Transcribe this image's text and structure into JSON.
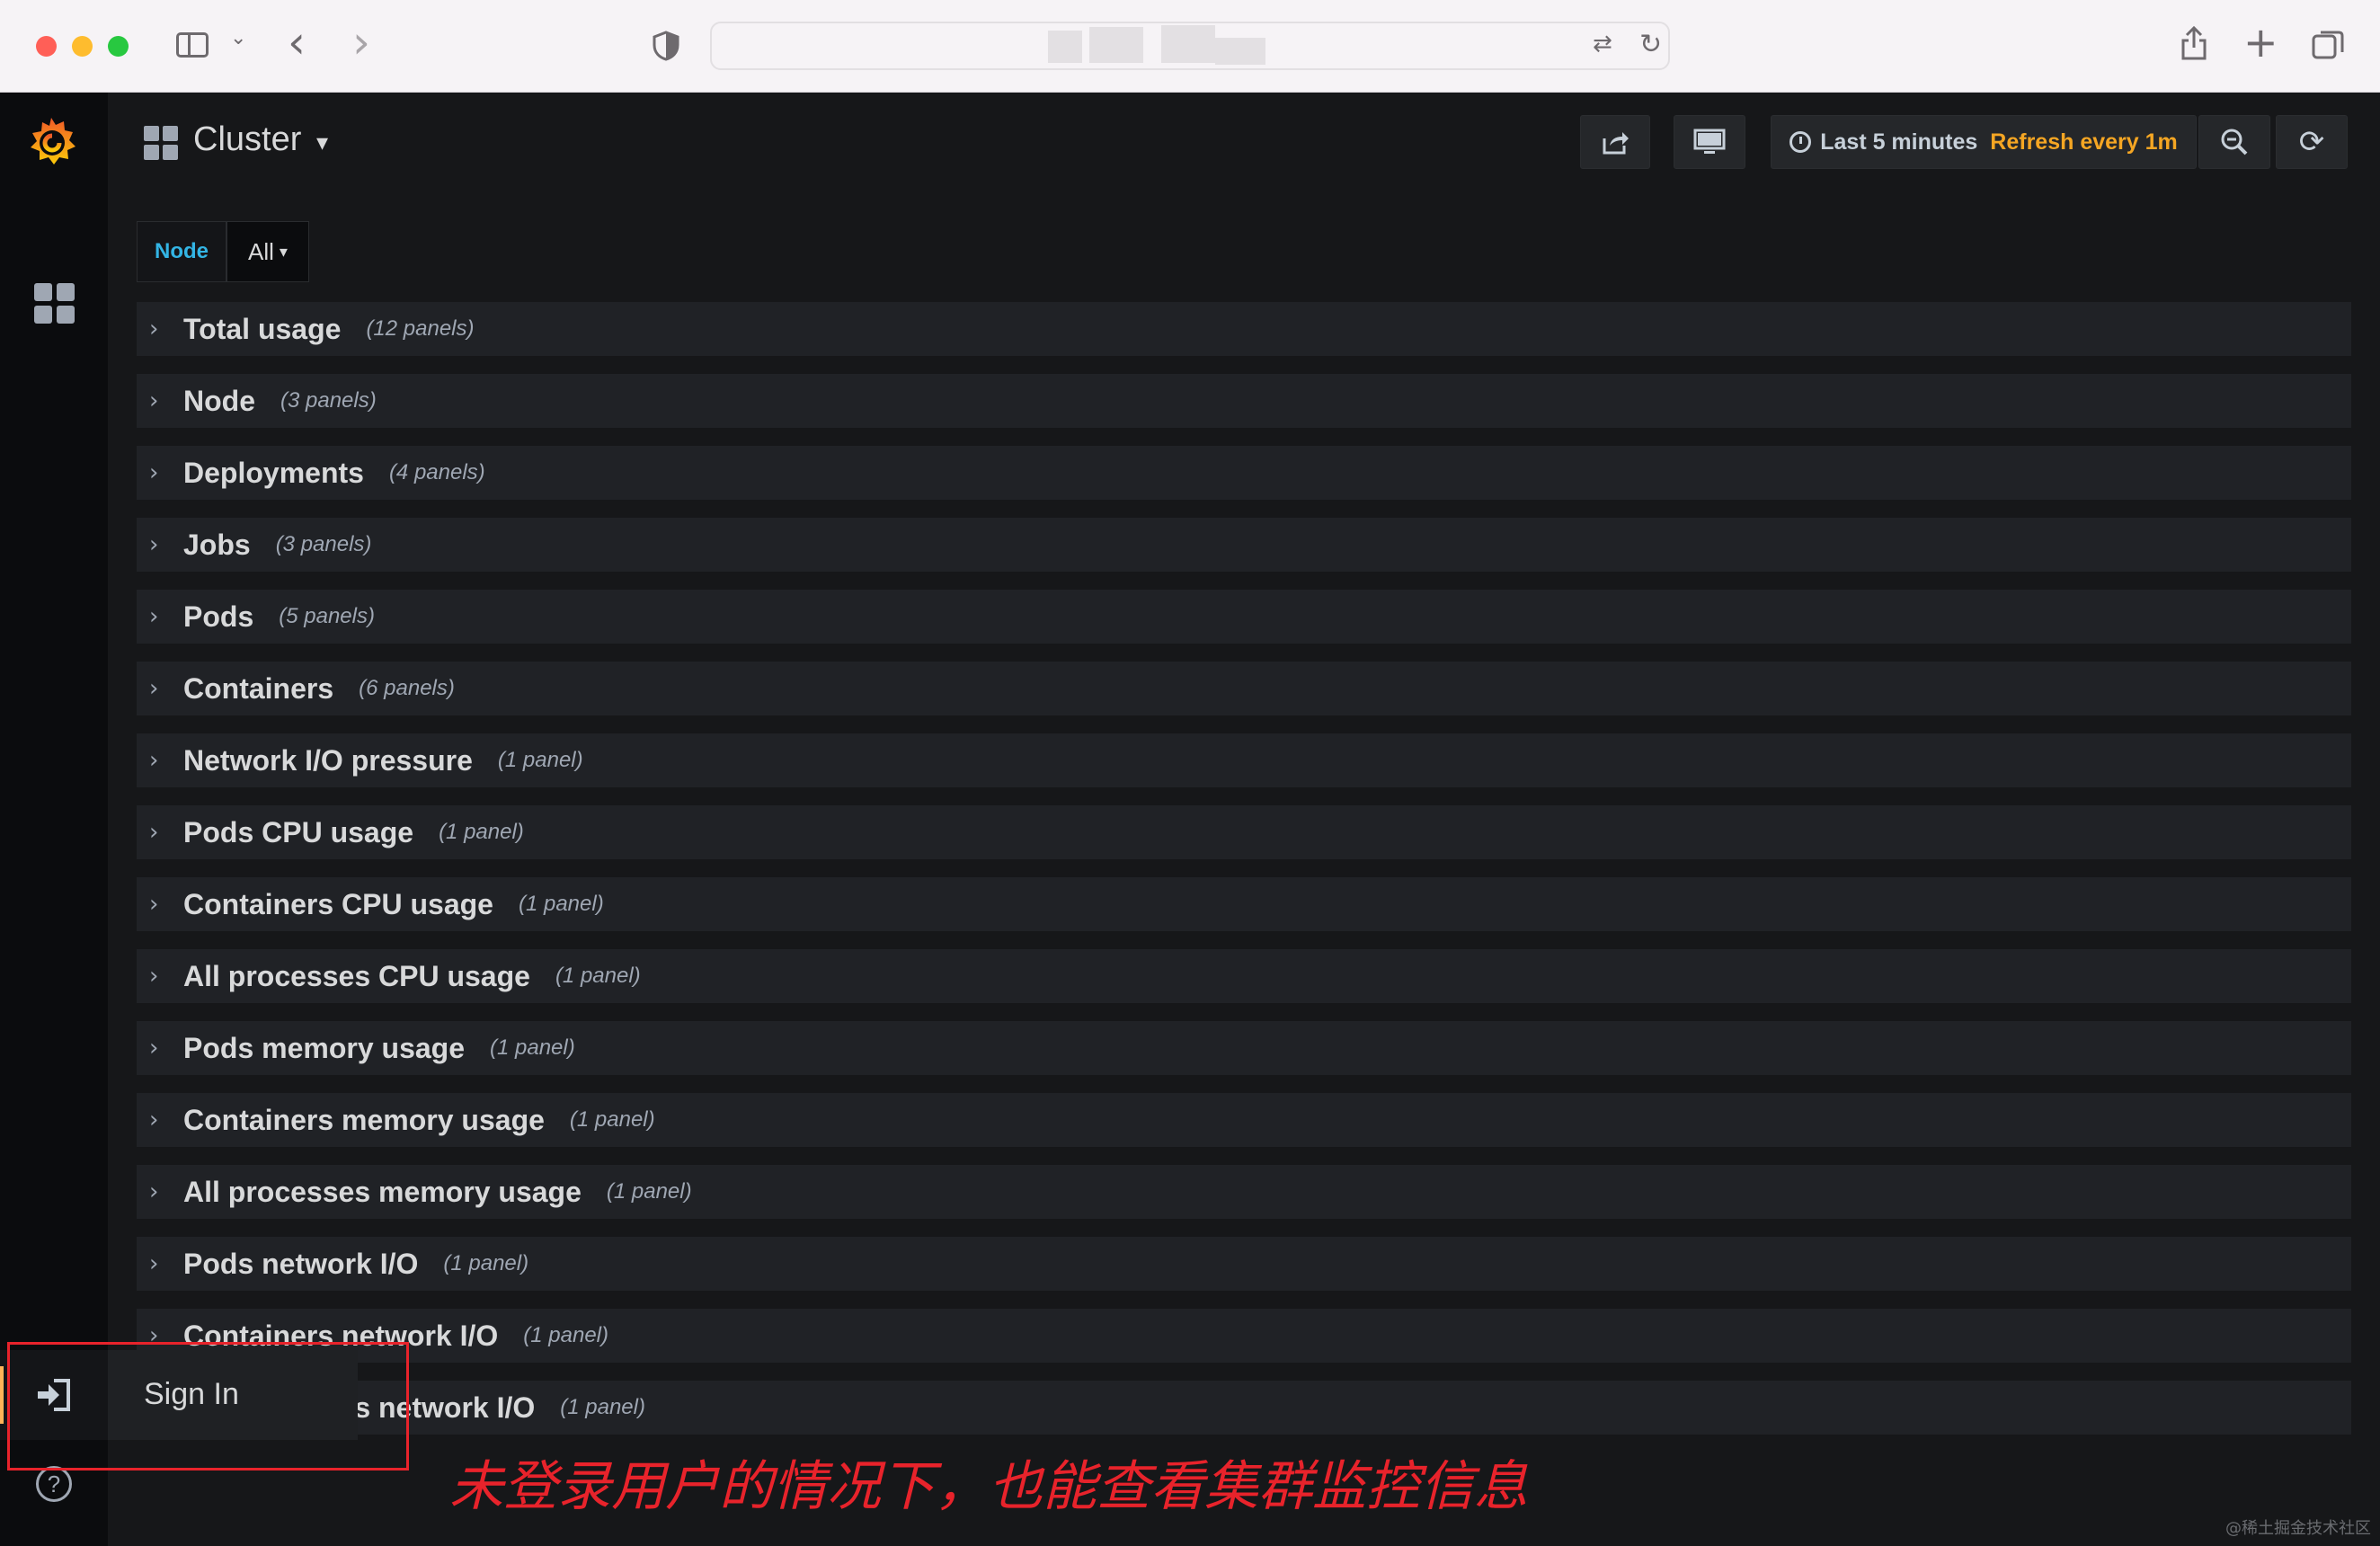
{
  "browser": {
    "icons": {
      "sidebar": "sidebar-icon",
      "back": "‹",
      "forward": "›",
      "shield": "shield-icon",
      "translate": "translate-icon",
      "reload": "↻",
      "share": "share-icon",
      "new_tab": "+",
      "tabs": "tabs-icon"
    },
    "colors": {
      "close": "#ff5f57",
      "minimize": "#febc2e",
      "zoom": "#28c840"
    }
  },
  "dashboard": {
    "title": "Cluster",
    "title_caret": "▾",
    "time_range": "Last 5 minutes",
    "refresh": "Refresh every 1m",
    "refresh_color": "#f5a623"
  },
  "variables": {
    "label": "Node",
    "value": "All",
    "caret": "▾"
  },
  "rows": [
    {
      "title": "Total usage",
      "count": "(12 panels)"
    },
    {
      "title": "Node",
      "count": "(3 panels)"
    },
    {
      "title": "Deployments",
      "count": "(4 panels)"
    },
    {
      "title": "Jobs",
      "count": "(3 panels)"
    },
    {
      "title": "Pods",
      "count": "(5 panels)"
    },
    {
      "title": "Containers",
      "count": "(6 panels)"
    },
    {
      "title": "Network I/O pressure",
      "count": "(1 panel)"
    },
    {
      "title": "Pods CPU usage",
      "count": "(1 panel)"
    },
    {
      "title": "Containers CPU usage",
      "count": "(1 panel)"
    },
    {
      "title": "All processes CPU usage",
      "count": "(1 panel)"
    },
    {
      "title": "Pods memory usage",
      "count": "(1 panel)"
    },
    {
      "title": "Containers memory usage",
      "count": "(1 panel)"
    },
    {
      "title": "All processes memory usage",
      "count": "(1 panel)"
    },
    {
      "title": "Pods network I/O",
      "count": "(1 panel)"
    },
    {
      "title": "Containers network I/O",
      "count": "(1 panel)"
    },
    {
      "title": "All processes network I/O",
      "count": "(1 panel)"
    }
  ],
  "sidebar": {
    "signin_label": "Sign In",
    "help": "?"
  },
  "annotation": "未登录用户的情况下，也能查看集群监控信息",
  "watermark": "@稀土掘金技术社区"
}
